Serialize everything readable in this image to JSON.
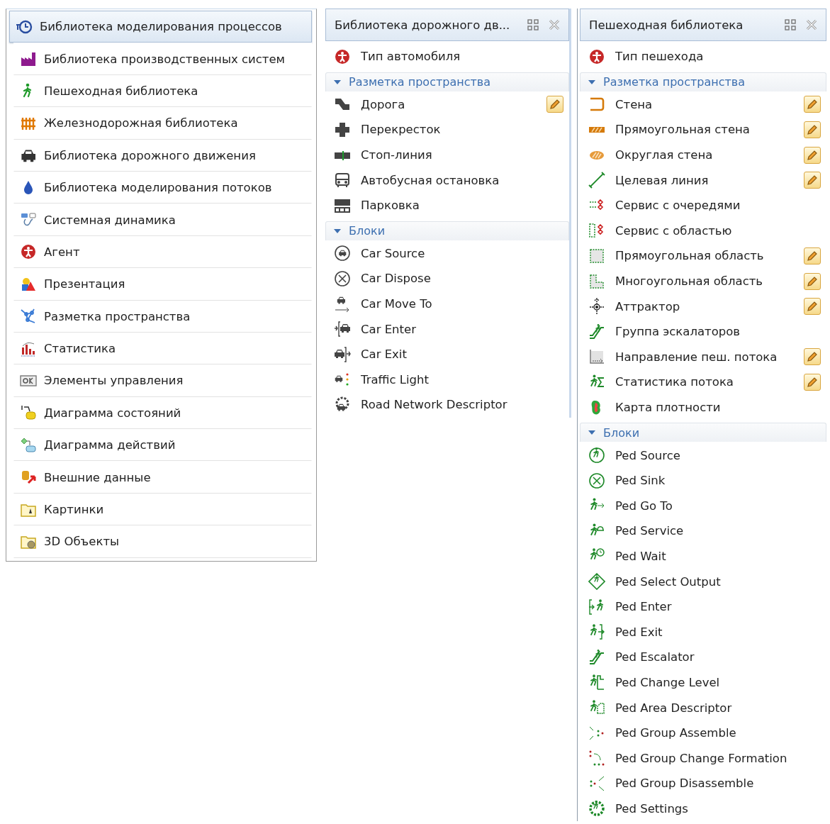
{
  "library_list": {
    "items": [
      {
        "label": "Библиотека моделирования процессов",
        "selected": true
      },
      {
        "label": "Библиотека производственных систем",
        "selected": false
      },
      {
        "label": "Пешеходная библиотека",
        "selected": false
      },
      {
        "label": "Железнодорожная библиотека",
        "selected": false
      },
      {
        "label": "Библиотека дорожного движения",
        "selected": false
      },
      {
        "label": "Библиотека моделирования потоков",
        "selected": false
      },
      {
        "label": "Системная динамика",
        "selected": false
      },
      {
        "label": "Агент",
        "selected": false
      },
      {
        "label": "Презентация",
        "selected": false
      },
      {
        "label": "Разметка пространства",
        "selected": false
      },
      {
        "label": "Статистика",
        "selected": false
      },
      {
        "label": "Элементы управления",
        "selected": false
      },
      {
        "label": "Диаграмма состояний",
        "selected": false
      },
      {
        "label": "Диаграмма действий",
        "selected": false
      },
      {
        "label": "Внешние данные",
        "selected": false
      },
      {
        "label": "Картинки",
        "selected": false
      },
      {
        "label": "3D Объекты",
        "selected": false
      }
    ]
  },
  "panels": [
    {
      "title": "Библиотека дорожного дв...",
      "top_item": {
        "label": "Тип автомобиля"
      },
      "sections": [
        {
          "title": "Разметка пространства",
          "expanded": true,
          "items": [
            {
              "label": "Дорога",
              "edit_button": true
            },
            {
              "label": "Перекресток",
              "edit_button": false
            },
            {
              "label": "Стоп-линия",
              "edit_button": false
            },
            {
              "label": "Автобусная остановка",
              "edit_button": false
            },
            {
              "label": "Парковка",
              "edit_button": false
            }
          ]
        },
        {
          "title": "Блоки",
          "expanded": true,
          "items": [
            {
              "label": "Car Source",
              "edit_button": false
            },
            {
              "label": "Car Dispose",
              "edit_button": false
            },
            {
              "label": "Car Move To",
              "edit_button": false
            },
            {
              "label": "Car Enter",
              "edit_button": false
            },
            {
              "label": "Car Exit",
              "edit_button": false
            },
            {
              "label": "Traffic Light",
              "edit_button": false
            },
            {
              "label": "Road Network Descriptor",
              "edit_button": false
            }
          ]
        }
      ]
    },
    {
      "title": "Пешеходная библиотека",
      "top_item": {
        "label": "Тип пешехода"
      },
      "sections": [
        {
          "title": "Разметка пространства",
          "expanded": true,
          "items": [
            {
              "label": "Стена",
              "edit_button": true
            },
            {
              "label": "Прямоугольная стена",
              "edit_button": true
            },
            {
              "label": "Округлая стена",
              "edit_button": true
            },
            {
              "label": "Целевая линия",
              "edit_button": true
            },
            {
              "label": "Сервис с очередями",
              "edit_button": false
            },
            {
              "label": "Сервис с областью",
              "edit_button": false
            },
            {
              "label": "Прямоугольная область",
              "edit_button": true
            },
            {
              "label": "Многоугольная область",
              "edit_button": true
            },
            {
              "label": "Аттрактор",
              "edit_button": true
            },
            {
              "label": "Группа эскалаторов",
              "edit_button": false
            },
            {
              "label": "Направление пеш. потока",
              "edit_button": true
            },
            {
              "label": "Статистика потока",
              "edit_button": true
            },
            {
              "label": "Карта плотности",
              "edit_button": false
            }
          ]
        },
        {
          "title": "Блоки",
          "expanded": true,
          "items": [
            {
              "label": "Ped Source",
              "edit_button": false
            },
            {
              "label": "Ped Sink",
              "edit_button": false
            },
            {
              "label": "Ped Go To",
              "edit_button": false
            },
            {
              "label": "Ped Service",
              "edit_button": false
            },
            {
              "label": "Ped Wait",
              "edit_button": false
            },
            {
              "label": "Ped Select Output",
              "edit_button": false
            },
            {
              "label": "Ped Enter",
              "edit_button": false
            },
            {
              "label": "Ped Exit",
              "edit_button": false
            },
            {
              "label": "Ped Escalator",
              "edit_button": false
            },
            {
              "label": "Ped Change Level",
              "edit_button": false
            },
            {
              "label": "Ped Area Descriptor",
              "edit_button": false
            },
            {
              "label": "Ped Group Assemble",
              "edit_button": false
            },
            {
              "label": "Ped Group Change Formation",
              "edit_button": false
            },
            {
              "label": "Ped Group Disassemble",
              "edit_button": false
            },
            {
              "label": "Ped Settings",
              "edit_button": false
            }
          ]
        }
      ]
    }
  ]
}
